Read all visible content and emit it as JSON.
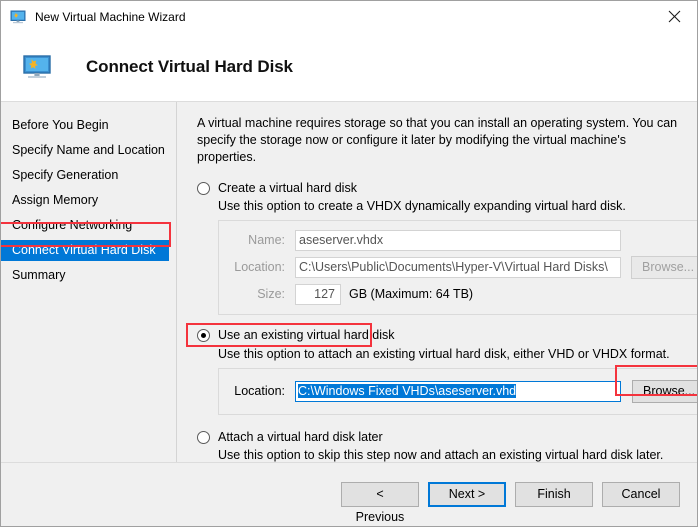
{
  "window": {
    "title": "New Virtual Machine Wizard",
    "titlebar_icon": "virtual-machine-icon",
    "close_icon": "close-icon"
  },
  "header": {
    "icon": "virtual-machine-icon",
    "title": "Connect Virtual Hard Disk"
  },
  "sidebar": {
    "items": [
      {
        "label": "Before You Begin",
        "selected": false
      },
      {
        "label": "Specify Name and Location",
        "selected": false
      },
      {
        "label": "Specify Generation",
        "selected": false
      },
      {
        "label": "Assign Memory",
        "selected": false
      },
      {
        "label": "Configure Networking",
        "selected": false
      },
      {
        "label": "Connect Virtual Hard Disk",
        "selected": true
      },
      {
        "label": "Summary",
        "selected": false
      }
    ]
  },
  "content": {
    "intro": "A virtual machine requires storage so that you can install an operating system. You can specify the storage now or configure it later by modifying the virtual machine's properties.",
    "options": [
      {
        "label": "Create a virtual hard disk",
        "description": "Use this option to create a VHDX dynamically expanding virtual hard disk.",
        "selected": false,
        "enabled": false
      },
      {
        "label": "Use an existing virtual hard disk",
        "description": "Use this option to attach an existing virtual hard disk, either VHD or VHDX format.",
        "selected": true,
        "enabled": true
      },
      {
        "label": "Attach a virtual hard disk later",
        "description": "Use this option to skip this step now and attach an existing virtual hard disk later.",
        "selected": false,
        "enabled": true
      }
    ],
    "create_group": {
      "name_label": "Name:",
      "name_value": "aseserver.vhdx",
      "location_label": "Location:",
      "location_value": "C:\\Users\\Public\\Documents\\Hyper-V\\Virtual Hard Disks\\",
      "browse_label": "Browse...",
      "size_label": "Size:",
      "size_value": "127",
      "size_suffix": "GB (Maximum: 64 TB)"
    },
    "existing_group": {
      "location_label": "Location:",
      "location_value": "C:\\Windows Fixed VHDs\\aseserver.vhd",
      "browse_label": "Browse..."
    }
  },
  "footer": {
    "previous_label": "< Previous",
    "next_label": "Next >",
    "finish_label": "Finish",
    "cancel_label": "Cancel"
  },
  "colors": {
    "accent": "#0078d7",
    "annotation": "#f4333d",
    "window_bg": "#f0f0f0"
  }
}
